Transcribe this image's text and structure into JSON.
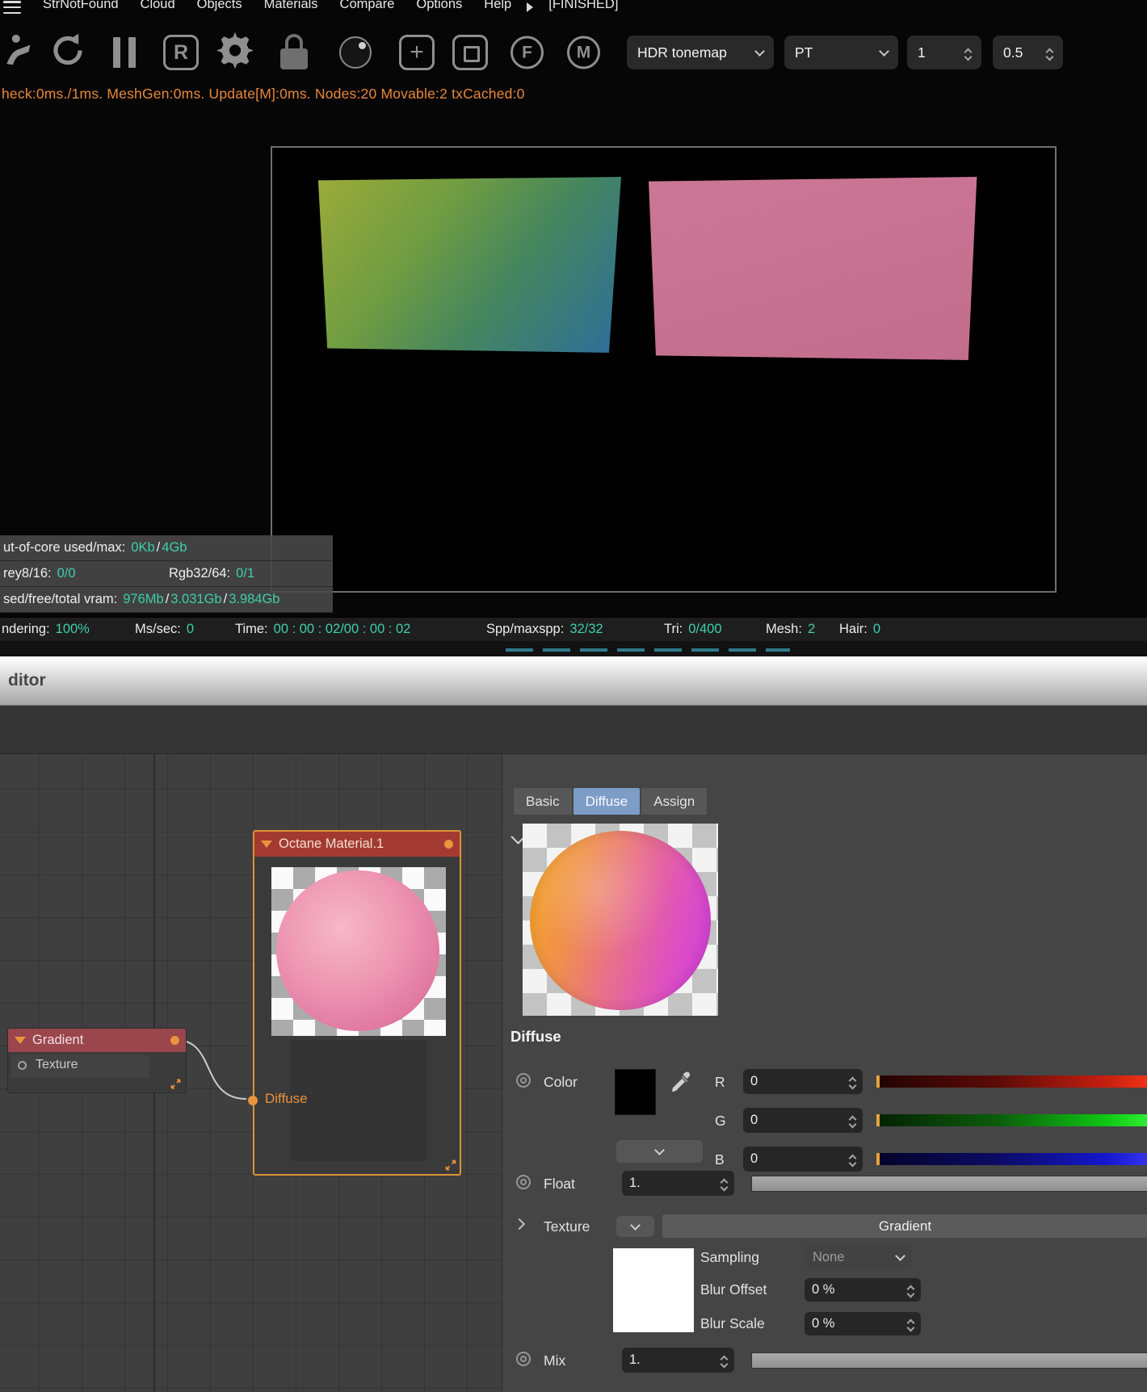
{
  "menu_bar": {
    "items": [
      "StrNotFound",
      "Cloud",
      "Objects",
      "Materials",
      "Compare",
      "Options",
      "Help"
    ],
    "finished_label": "[FINISHED]"
  },
  "toolbar": {
    "region_button": "R",
    "add_button": "+",
    "focus_button": "F",
    "material_button": "M",
    "tonemap_dropdown": "HDR tonemap",
    "kernel_dropdown": "PT",
    "samples_spinner": "1",
    "scale_spinner": "0.5"
  },
  "perf_line": "heck:0ms./1ms. MeshGen:0ms. Update[M]:0ms. Nodes:20 Movable:2 txCached:0",
  "stats_overlay": {
    "row1_label": "ut-of-core used/max:",
    "row1_value1": "0Kb",
    "row1_sep": "/",
    "row1_value2": "4Gb",
    "row2_label1": "rey8/16:",
    "row2_value1": "0/0",
    "row2_label2": "Rgb32/64:",
    "row2_value2": "0/1",
    "row3_label": "sed/free/total vram:",
    "row3_value1": "976Mb",
    "row3_sep1": "/",
    "row3_value2": "3.031Gb",
    "row3_sep2": "/",
    "row3_value3": "3.984Gb"
  },
  "status_bar": {
    "items": [
      {
        "label": "ndering:",
        "value": "100%"
      },
      {
        "label": "Ms/sec:",
        "value": "0"
      },
      {
        "label": "Time:",
        "value": "00 : 00 : 02/00 : 00 : 02"
      },
      {
        "label": "Spp/maxspp:",
        "value": "32/32"
      },
      {
        "label": "Tri:",
        "value": "0/400"
      },
      {
        "label": "Mesh:",
        "value": "2"
      },
      {
        "label": "Hair:",
        "value": "0"
      }
    ]
  },
  "editor_window": {
    "title": "ditor"
  },
  "node_editor": {
    "material_node": {
      "title": "Octane Material.1",
      "input_port": "Diffuse"
    },
    "gradient_node": {
      "title": "Gradient",
      "input_port": "Texture"
    }
  },
  "panel": {
    "tabs": [
      "Basic",
      "Diffuse",
      "Assign"
    ],
    "active_tab": "Diffuse",
    "section_title": "Diffuse",
    "color": {
      "label": "Color",
      "r_label": "R",
      "r": "0",
      "g_label": "G",
      "g": "0",
      "b_label": "B",
      "b": "0"
    },
    "float": {
      "label": "Float",
      "value": "1."
    },
    "texture": {
      "label": "Texture",
      "button": "Gradient"
    },
    "sampling": {
      "label": "Sampling",
      "value": "None"
    },
    "blur_offset": {
      "label": "Blur Offset",
      "value": "0 %"
    },
    "blur_scale": {
      "label": "Blur Scale",
      "value": "0 %"
    },
    "mix": {
      "label": "Mix",
      "value": "1."
    }
  },
  "icons": {
    "hamburger_icon": "three-bars",
    "octane_logo_icon": "octane-figure",
    "refresh_icon": "circular-arrow",
    "pause_icon": "two-bars",
    "gear_icon": "gear",
    "lock_icon": "padlock",
    "sphere_icon": "filled-ball",
    "expand_icon": "diagonal-arrows",
    "eyedropper_icon": "color-picker",
    "chevron_down_icon": "v-caret"
  },
  "colors": {
    "accent_orange": "#e8953c",
    "value_teal": "#3ecfaa",
    "perf_text_orange": "#e8883b",
    "material_node_header": "#a33a31",
    "gradient_node_header": "#9a464c",
    "active_tab_blue": "#7d9cc6"
  }
}
